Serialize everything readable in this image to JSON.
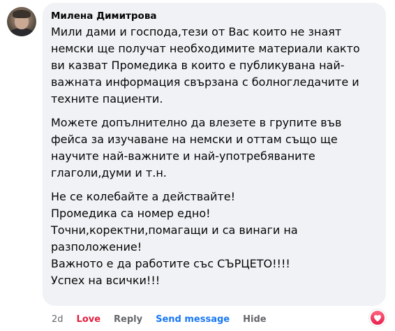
{
  "comment": {
    "author": "Милена Димитрова",
    "paragraphs": [
      [
        "Мили дами и господа,тези от Вас които не знаят",
        "немски ще получат необходимите материали както",
        "ви казват Промедика в които е публикувана най-",
        "важната информация свързана с болногледачите и",
        "техните пациенти."
      ],
      [
        "Можете допълнително да влезете в групите във",
        "фейса за изучаване на немски и оттам също ще",
        "научите най-важните и най-употребяваните",
        "глаголи,думи и т.н."
      ],
      [
        "Не се колебайте а действайте!",
        "Промедика са номер едно!",
        "Точни,коректни,помагащи и са винаги на",
        "разположение!",
        "Важното е да работите със СЪРЦЕТО!!!!",
        "Успех на всички!!!"
      ]
    ]
  },
  "actions": {
    "time": "2d",
    "love": "Love",
    "reply": "Reply",
    "send_message": "Send message",
    "hide": "Hide"
  },
  "reaction": {
    "icon": "heart-icon",
    "color": "#e41e3f"
  }
}
